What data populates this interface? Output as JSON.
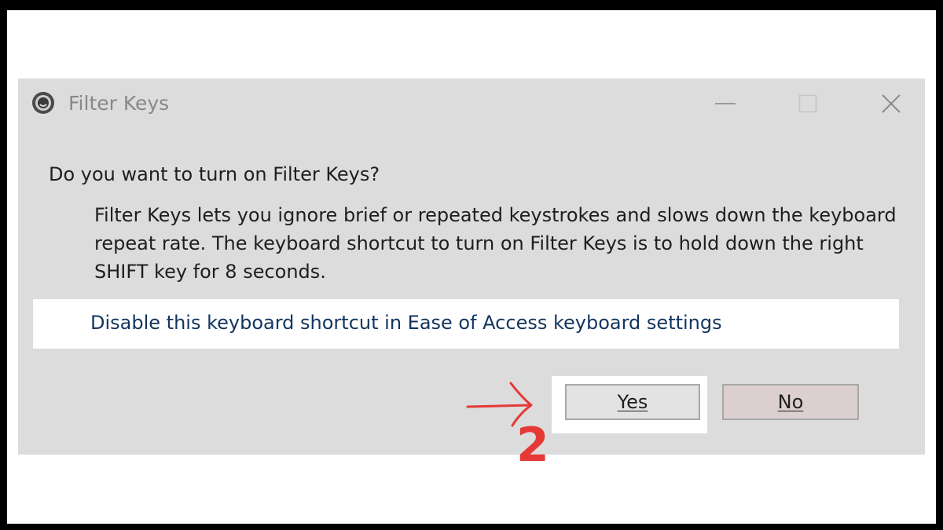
{
  "dialog": {
    "title": "Filter Keys",
    "app_icon": "accessibility-clock-icon",
    "controls": {
      "minimize_icon": "minimize-icon",
      "maximize_icon": "maximize-icon",
      "close_icon": "close-icon"
    },
    "question": "Do you want to turn on Filter Keys?",
    "description": "Filter Keys lets you ignore brief or repeated keystrokes and slows down the keyboard repeat rate.  The keyboard shortcut to turn on Filter Keys is to hold down the right SHIFT key for 8 seconds.",
    "link": "Disable this keyboard shortcut in Ease of Access keyboard settings",
    "buttons": {
      "yes": "Yes",
      "no": "No"
    }
  },
  "annotation": {
    "step_number": "2",
    "arrow_icon": "right-arrow-icon",
    "color": "#e53935"
  },
  "colors": {
    "dialog_bg": "#dcdcdc",
    "link": "#12355e",
    "annotation_red": "#e53935"
  }
}
